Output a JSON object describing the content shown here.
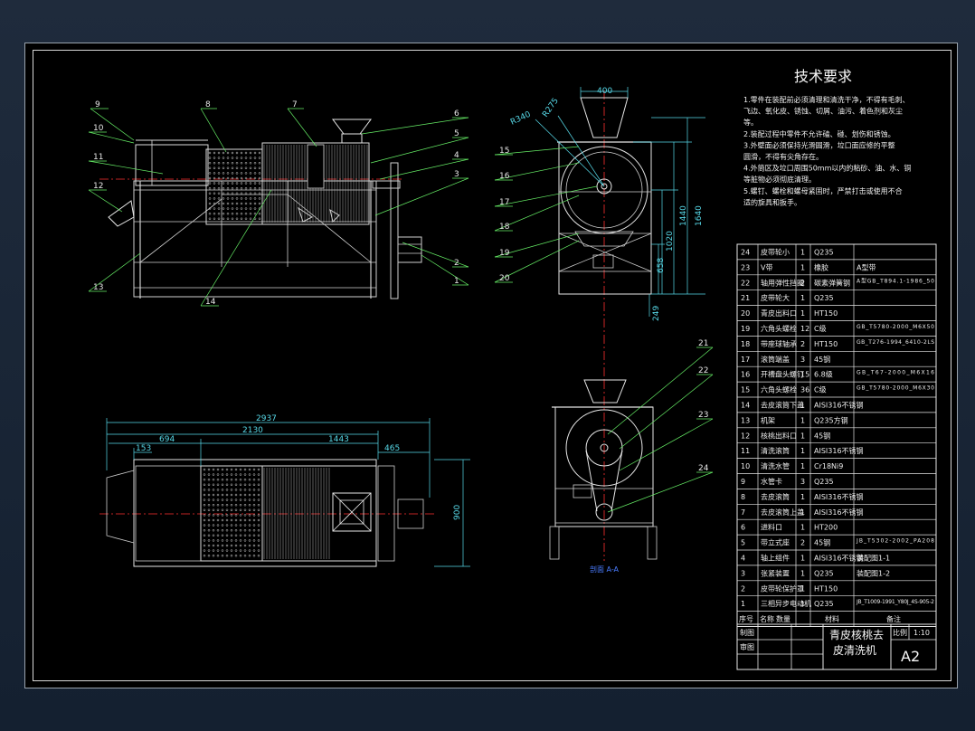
{
  "colors": {
    "outline": "#e6e6e6",
    "part_outline": "#cfcfcf",
    "dimension": "#57d9e8",
    "centerline": "#ff3030",
    "leader": "#66ee66",
    "caption": "#4a7cff",
    "background": "#000000"
  },
  "tech": {
    "title": "技术要求",
    "lines": [
      "1.零件在装配前必须清理和清洗干净，不得有毛刺、",
      "飞边、氧化皮、锈蚀、切屑、油污、着色剂和灰尘",
      "等。",
      "2.装配过程中零件不允许磕、碰、划伤和锈蚀。",
      "3.外壁面必须保持光滑圆滑，垃口面应修的平整",
      "圆滑，不得有尖角存在。",
      "4.外筒区及垃口周围50mm以内的粘砂、油、水、铜",
      "等脏物必须彻底清理。",
      "5.螺钉、螺栓和螺母紧固时，严禁打击或使用不合",
      "适的旋具和扳手。"
    ]
  },
  "front_view": {
    "callouts": [
      "9",
      "10",
      "11",
      "12",
      "13",
      "14",
      "8",
      "7",
      "6",
      "5",
      "4",
      "3",
      "2",
      "1"
    ]
  },
  "side_view": {
    "callouts": [
      "15",
      "16",
      "17",
      "18",
      "19",
      "20"
    ],
    "dims": {
      "top_width": "400",
      "r1": "R340",
      "r2": "R275",
      "h1": "1640",
      "h2": "1440",
      "h3": "1020",
      "h4": "658",
      "h5": "249"
    }
  },
  "top_view": {
    "dims": {
      "overall": "2937",
      "d2130": "2130",
      "d694": "694",
      "d153": "153",
      "d1443": "1443",
      "d465": "465",
      "d900": "900"
    }
  },
  "section_view": {
    "callouts": [
      "21",
      "22",
      "23",
      "24"
    ],
    "caption": "剖面 A-A"
  },
  "bom": {
    "rows": [
      {
        "no": "24",
        "name": "皮带轮小",
        "qty": "1",
        "material": "Q235",
        "note": ""
      },
      {
        "no": "23",
        "name": "V带",
        "qty": "1",
        "material": "橡胶",
        "note": "A型带"
      },
      {
        "no": "22",
        "name": "轴用弹性挡圈",
        "qty": "2",
        "material": "碳素弹簧钢",
        "note": "A型GB_T894.1-1986_50"
      },
      {
        "no": "21",
        "name": "皮带轮大",
        "qty": "1",
        "material": "Q235",
        "note": ""
      },
      {
        "no": "20",
        "name": "青皮出料口",
        "qty": "1",
        "material": "HT150",
        "note": ""
      },
      {
        "no": "19",
        "name": "六角头螺栓",
        "qty": "12",
        "material": "C级",
        "note": "GB_T5780-2000_M6X50"
      },
      {
        "no": "18",
        "name": "带座球轴承",
        "qty": "2",
        "material": "HT150",
        "note": "GB_T276-1994_6410-2LS"
      },
      {
        "no": "17",
        "name": "滚筒端盖",
        "qty": "3",
        "material": "45钢",
        "note": ""
      },
      {
        "no": "16",
        "name": "开槽盘头螺钉",
        "qty": "15",
        "material": "6.8级",
        "note": "GB_T67-2000_M6X16"
      },
      {
        "no": "15",
        "name": "六角头螺栓",
        "qty": "36",
        "material": "C级",
        "note": "GB_T5780-2000_M6X30"
      },
      {
        "no": "14",
        "name": "去皮滚筒下盖",
        "qty": "1",
        "material": "AISI316不锈钢",
        "note": ""
      },
      {
        "no": "13",
        "name": "机架",
        "qty": "1",
        "material": "Q235方钢",
        "note": ""
      },
      {
        "no": "12",
        "name": "核桃出料口",
        "qty": "1",
        "material": "45钢",
        "note": ""
      },
      {
        "no": "11",
        "name": "清洗滚筒",
        "qty": "1",
        "material": "AISI316不锈钢",
        "note": ""
      },
      {
        "no": "10",
        "name": "清洗水管",
        "qty": "1",
        "material": "Cr18Ni9",
        "note": ""
      },
      {
        "no": "9",
        "name": "水管卡",
        "qty": "3",
        "material": "Q235",
        "note": ""
      },
      {
        "no": "8",
        "name": "去皮滚筒",
        "qty": "1",
        "material": "AISI316不锈钢",
        "note": ""
      },
      {
        "no": "7",
        "name": "去皮滚筒上盖",
        "qty": "1",
        "material": "AISI316不锈钢",
        "note": ""
      },
      {
        "no": "6",
        "name": "进料口",
        "qty": "1",
        "material": "HT200",
        "note": ""
      },
      {
        "no": "5",
        "name": "带立式座",
        "qty": "2",
        "material": "45钢",
        "note": "JB_T5302-2002_PA208"
      },
      {
        "no": "4",
        "name": "轴上组件",
        "qty": "1",
        "material": "AISI316不锈钢",
        "note": "装配图1-1"
      },
      {
        "no": "3",
        "name": "张紧装置",
        "qty": "1",
        "material": "Q235",
        "note": "装配图1-2"
      },
      {
        "no": "2",
        "name": "皮带轮保护罩",
        "qty": "1",
        "material": "HT150",
        "note": ""
      },
      {
        "no": "1",
        "name": "三相异步电动机",
        "qty": "1",
        "material": "Q235",
        "note": "JB_T1009-1991_Y80J_4S-905-2"
      }
    ],
    "header": {
      "no": "序号",
      "name": "名称",
      "qty": "数量",
      "material": "材料",
      "note": "备注"
    }
  },
  "title_block": {
    "draw_label": "制图",
    "review_label": "审图",
    "title_line1": "青皮核桃去",
    "title_line2": "皮清洗机",
    "scale_label": "比例",
    "scale_value": "1:10",
    "sheet_size": "A2"
  }
}
